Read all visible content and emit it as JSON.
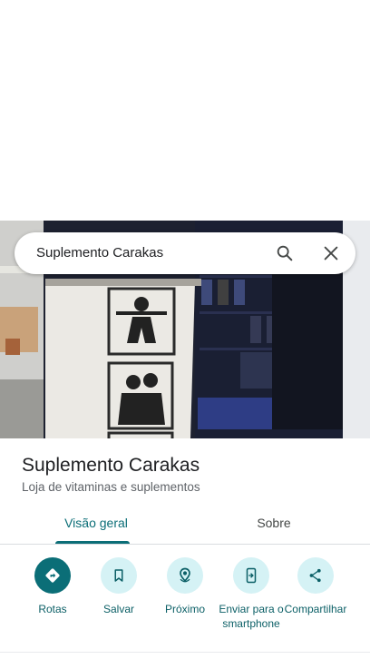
{
  "search": {
    "query": "Suplemento Carakas"
  },
  "place": {
    "name": "Suplemento Carakas",
    "category": "Loja de vitaminas e suplementos"
  },
  "tabs": [
    {
      "label": "Visão geral",
      "active": true
    },
    {
      "label": "Sobre",
      "active": false
    }
  ],
  "actions": [
    {
      "label": "Rotas",
      "icon": "directions-icon"
    },
    {
      "label": "Salvar",
      "icon": "bookmark-icon"
    },
    {
      "label": "Próximo",
      "icon": "nearby-icon"
    },
    {
      "label": "Enviar para o smartphone",
      "icon": "send-to-phone-icon"
    },
    {
      "label": "Compartilhar",
      "icon": "share-icon"
    }
  ],
  "colors": {
    "accent": "#0b6e77",
    "action_bg": "#d5f2f5",
    "text_secondary": "#5f6368"
  }
}
